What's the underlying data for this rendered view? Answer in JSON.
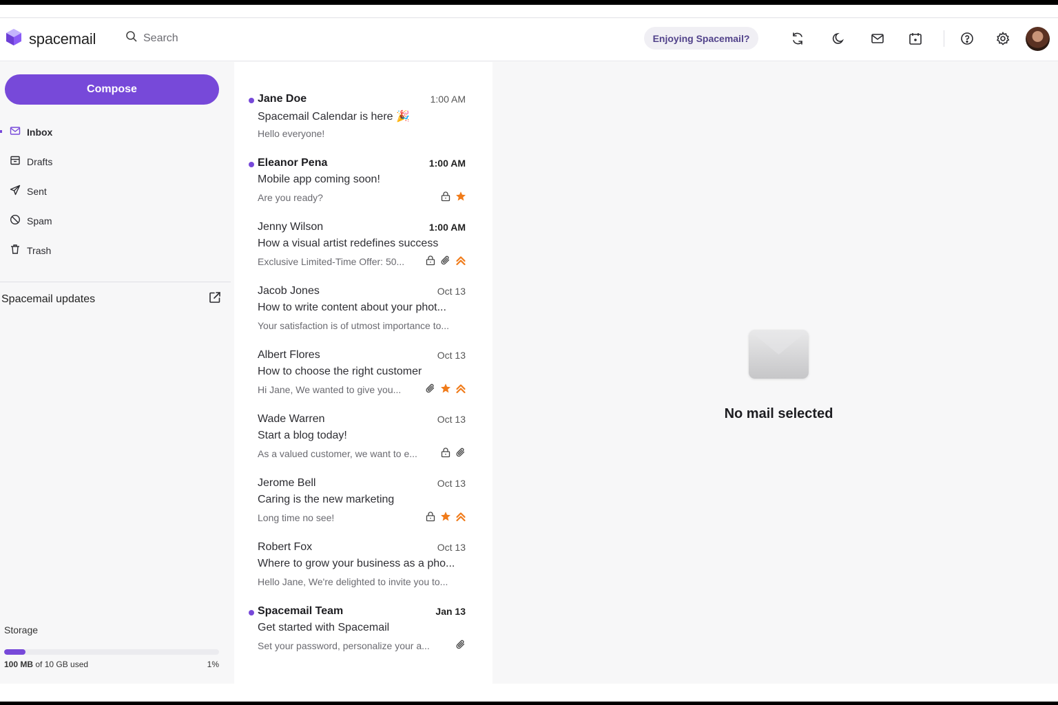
{
  "header": {
    "logo_text": "spacemail",
    "search_placeholder": "Search",
    "enjoy_button": "Enjoying Spacemail?",
    "icons": [
      "refresh-icon",
      "moon-icon",
      "mail-icon",
      "calendar-icon",
      "help-icon",
      "gear-icon"
    ]
  },
  "sidebar": {
    "compose_label": "Compose",
    "items": [
      {
        "label": "Inbox",
        "icon": "inbox-icon",
        "active": true
      },
      {
        "label": "Drafts",
        "icon": "drafts-icon"
      },
      {
        "label": "Sent",
        "icon": "send-icon"
      },
      {
        "label": "Spam",
        "icon": "spam-icon"
      },
      {
        "label": "Trash",
        "icon": "trash-icon"
      }
    ],
    "updates_label": "Spacemail updates",
    "storage": {
      "label": "Storage",
      "used": "100 MB",
      "rest": " of 10 GB used",
      "percent_text": "1%",
      "fraction": 0.1
    }
  },
  "emails": [
    {
      "sender": "Jane Doe",
      "time": "1:00 AM",
      "subject": "Spacemail Calendar is here 🎉",
      "preview": "Hello everyone!",
      "unread": true,
      "time_bold": false,
      "badges": []
    },
    {
      "sender": "Eleanor Pena",
      "time": "1:00 AM",
      "subject": "Mobile app coming soon!",
      "preview": "Are you ready?",
      "unread": true,
      "time_bold": true,
      "badges": [
        "lock",
        "star"
      ]
    },
    {
      "sender": "Jenny Wilson",
      "time": "1:00 AM",
      "subject": "How a visual artist redefines success",
      "preview": "Exclusive Limited-Time Offer: 50...",
      "unread": false,
      "time_bold": true,
      "badges": [
        "lock",
        "clip",
        "priority"
      ]
    },
    {
      "sender": "Jacob Jones",
      "time": "Oct 13",
      "subject": "How to write content about your phot...",
      "preview": "Your satisfaction is of utmost importance to...",
      "unread": false,
      "time_bold": false,
      "badges": []
    },
    {
      "sender": "Albert Flores",
      "time": "Oct 13",
      "subject": "How to choose the right customer",
      "preview": "Hi Jane, We wanted to give you...",
      "unread": false,
      "time_bold": false,
      "badges": [
        "clip",
        "star",
        "priority"
      ]
    },
    {
      "sender": "Wade Warren",
      "time": "Oct 13",
      "subject": "Start a blog today!",
      "preview": "As a valued customer, we want to e...",
      "unread": false,
      "time_bold": false,
      "badges": [
        "lock",
        "clip"
      ]
    },
    {
      "sender": "Jerome Bell",
      "time": "Oct 13",
      "subject": "Caring is the new marketing",
      "preview": "Long time no see!",
      "unread": false,
      "time_bold": false,
      "badges": [
        "lock",
        "star",
        "priority"
      ]
    },
    {
      "sender": "Robert Fox",
      "time": "Oct 13",
      "subject": "Where to grow your business as a pho...",
      "preview": "Hello Jane, We're delighted to invite you to...",
      "unread": false,
      "time_bold": false,
      "badges": []
    },
    {
      "sender": "Spacemail Team",
      "time": "Jan 13",
      "subject": "Get started with Spacemail",
      "preview": "Set your password, personalize your a...",
      "unread": true,
      "time_bold": true,
      "badges": [
        "clip"
      ]
    }
  ],
  "detail": {
    "empty_text": "No mail selected"
  },
  "colors": {
    "accent": "#7749d9",
    "star": "#f07b1a",
    "enjoy_text": "#51428a"
  }
}
